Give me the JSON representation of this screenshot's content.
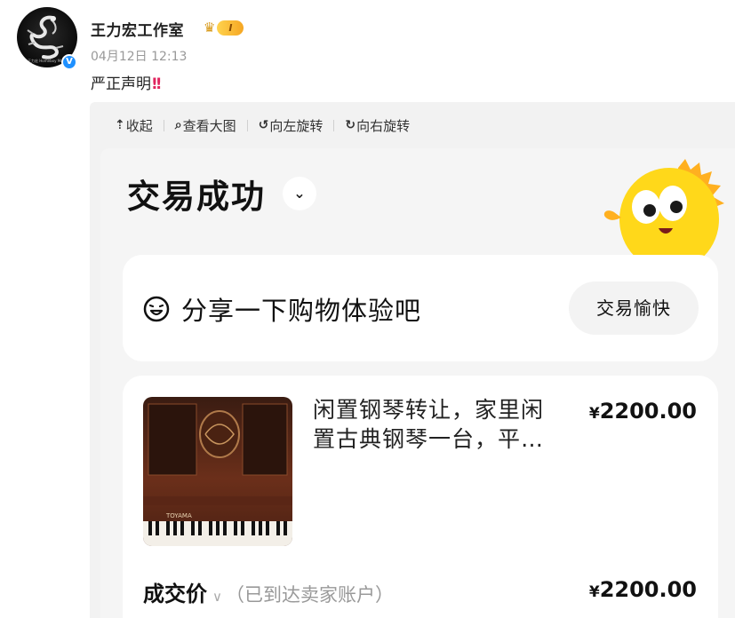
{
  "post": {
    "username": "王力宏工作室",
    "vip_level": "I",
    "timestamp": "04月12日 12:13",
    "text": "严正声明",
    "emphasis": "!!",
    "avatar_caption": "王力宏 Homeboy Music",
    "verified_mark": "V"
  },
  "viewer_toolbar": {
    "collapse": "收起",
    "view_large": "查看大图",
    "rotate_left": "向左旋转",
    "rotate_right": "向右旋转"
  },
  "order": {
    "status": "交易成功",
    "share_prompt": "分享一下购物体验吧",
    "happy_button": "交易愉快",
    "product_title_line1": "闲置钢琴转让，家里闲",
    "product_title_line2": "置古典钢琴一台，平…",
    "product_price": "2200.00",
    "currency": "¥",
    "deal_label": "成交价",
    "deal_note": "（已到达卖家账户）",
    "deal_price": "2200.00",
    "piano_brand": "TOYAMA"
  },
  "colors": {
    "verified": "#1e90ff",
    "vip_gold": "#f5a623",
    "mascot_yellow": "#ffd81a",
    "mascot_orange": "#ffb020"
  },
  "icons": [
    "upload-arrow-icon",
    "search-icon",
    "rotate-left-icon",
    "rotate-right-icon",
    "chevron-down-icon",
    "laugh-face-icon",
    "crown-icon"
  ]
}
